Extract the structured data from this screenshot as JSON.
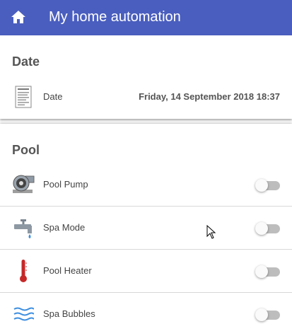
{
  "header": {
    "title": "My home automation",
    "home_icon": "home-icon",
    "color": "#4a5ebf"
  },
  "date_card": {
    "title": "Date",
    "row": {
      "label": "Date",
      "value": "Friday, 14 September 2018 18:37",
      "icon": "document-icon"
    }
  },
  "pool_card": {
    "title": "Pool",
    "items": [
      {
        "label": "Pool Pump",
        "icon": "pump-icon",
        "on": false
      },
      {
        "label": "Spa Mode",
        "icon": "faucet-icon",
        "on": false
      },
      {
        "label": "Pool Heater",
        "icon": "thermometer-icon",
        "on": false
      },
      {
        "label": "Spa Bubbles",
        "icon": "water-waves-icon",
        "on": false
      }
    ]
  }
}
